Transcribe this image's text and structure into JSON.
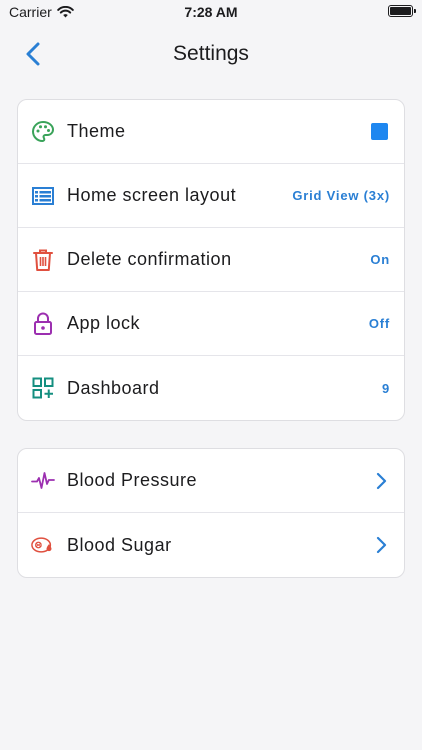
{
  "status_bar": {
    "carrier": "Carrier",
    "time": "7:28 AM"
  },
  "nav": {
    "title": "Settings"
  },
  "settings": [
    {
      "label": "Theme",
      "icon": "palette-icon",
      "icon_color": "#3aa35a",
      "value": "",
      "swatch_color": "#1e87f0"
    },
    {
      "label": "Home screen layout",
      "icon": "list-layout-icon",
      "icon_color": "#2a7fd4",
      "value": "Grid View (3x)"
    },
    {
      "label": "Delete confirmation",
      "icon": "trash-icon",
      "icon_color": "#e0503f",
      "value": "On"
    },
    {
      "label": "App lock",
      "icon": "lock-icon",
      "icon_color": "#9c2fb0",
      "value": "Off"
    },
    {
      "label": "Dashboard",
      "icon": "dashboard-add-icon",
      "icon_color": "#158f80",
      "value": "9"
    }
  ],
  "health": [
    {
      "label": "Blood Pressure",
      "icon": "heartbeat-icon",
      "icon_color": "#9c2fb0"
    },
    {
      "label": "Blood Sugar",
      "icon": "blood-sugar-icon",
      "icon_color": "#e0503f"
    }
  ],
  "colors": {
    "accent": "#2a7fd4",
    "background": "#f5f5f7"
  }
}
